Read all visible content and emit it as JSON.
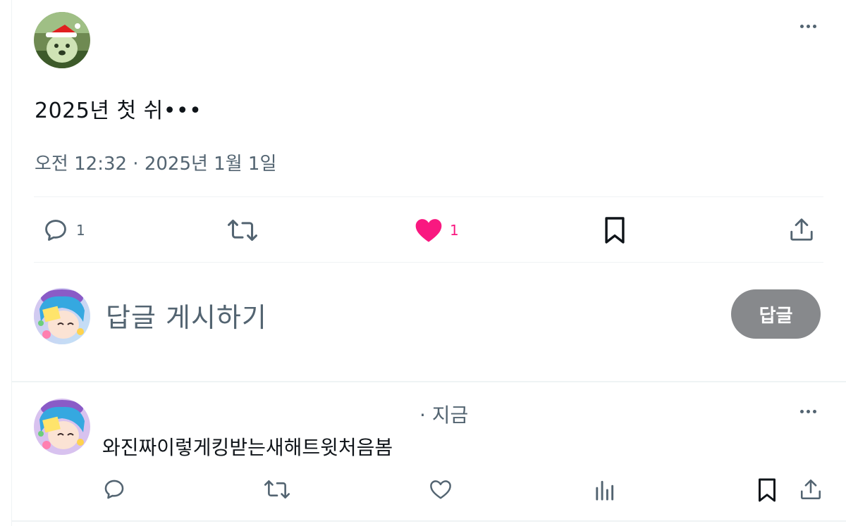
{
  "tweet": {
    "text": "2025년 첫 쉬•••",
    "timestamp": "오전 12:32 · 2025년 1월 1일",
    "actions": {
      "reply_count": "1",
      "like_count": "1",
      "like_color": "#f91880"
    },
    "icons": [
      "reply-icon",
      "retweet-icon",
      "heart-icon",
      "bookmark-icon",
      "share-icon",
      "more-icon"
    ]
  },
  "compose": {
    "placeholder": "답글 게시하기",
    "button_label": "답글"
  },
  "reply": {
    "time": "· 지금",
    "text": "와진짜이렇게킹받는새해트윗처음봄",
    "icons": [
      "reply-icon",
      "retweet-icon",
      "heart-icon",
      "views-icon",
      "bookmark-icon",
      "share-icon",
      "more-icon"
    ]
  }
}
